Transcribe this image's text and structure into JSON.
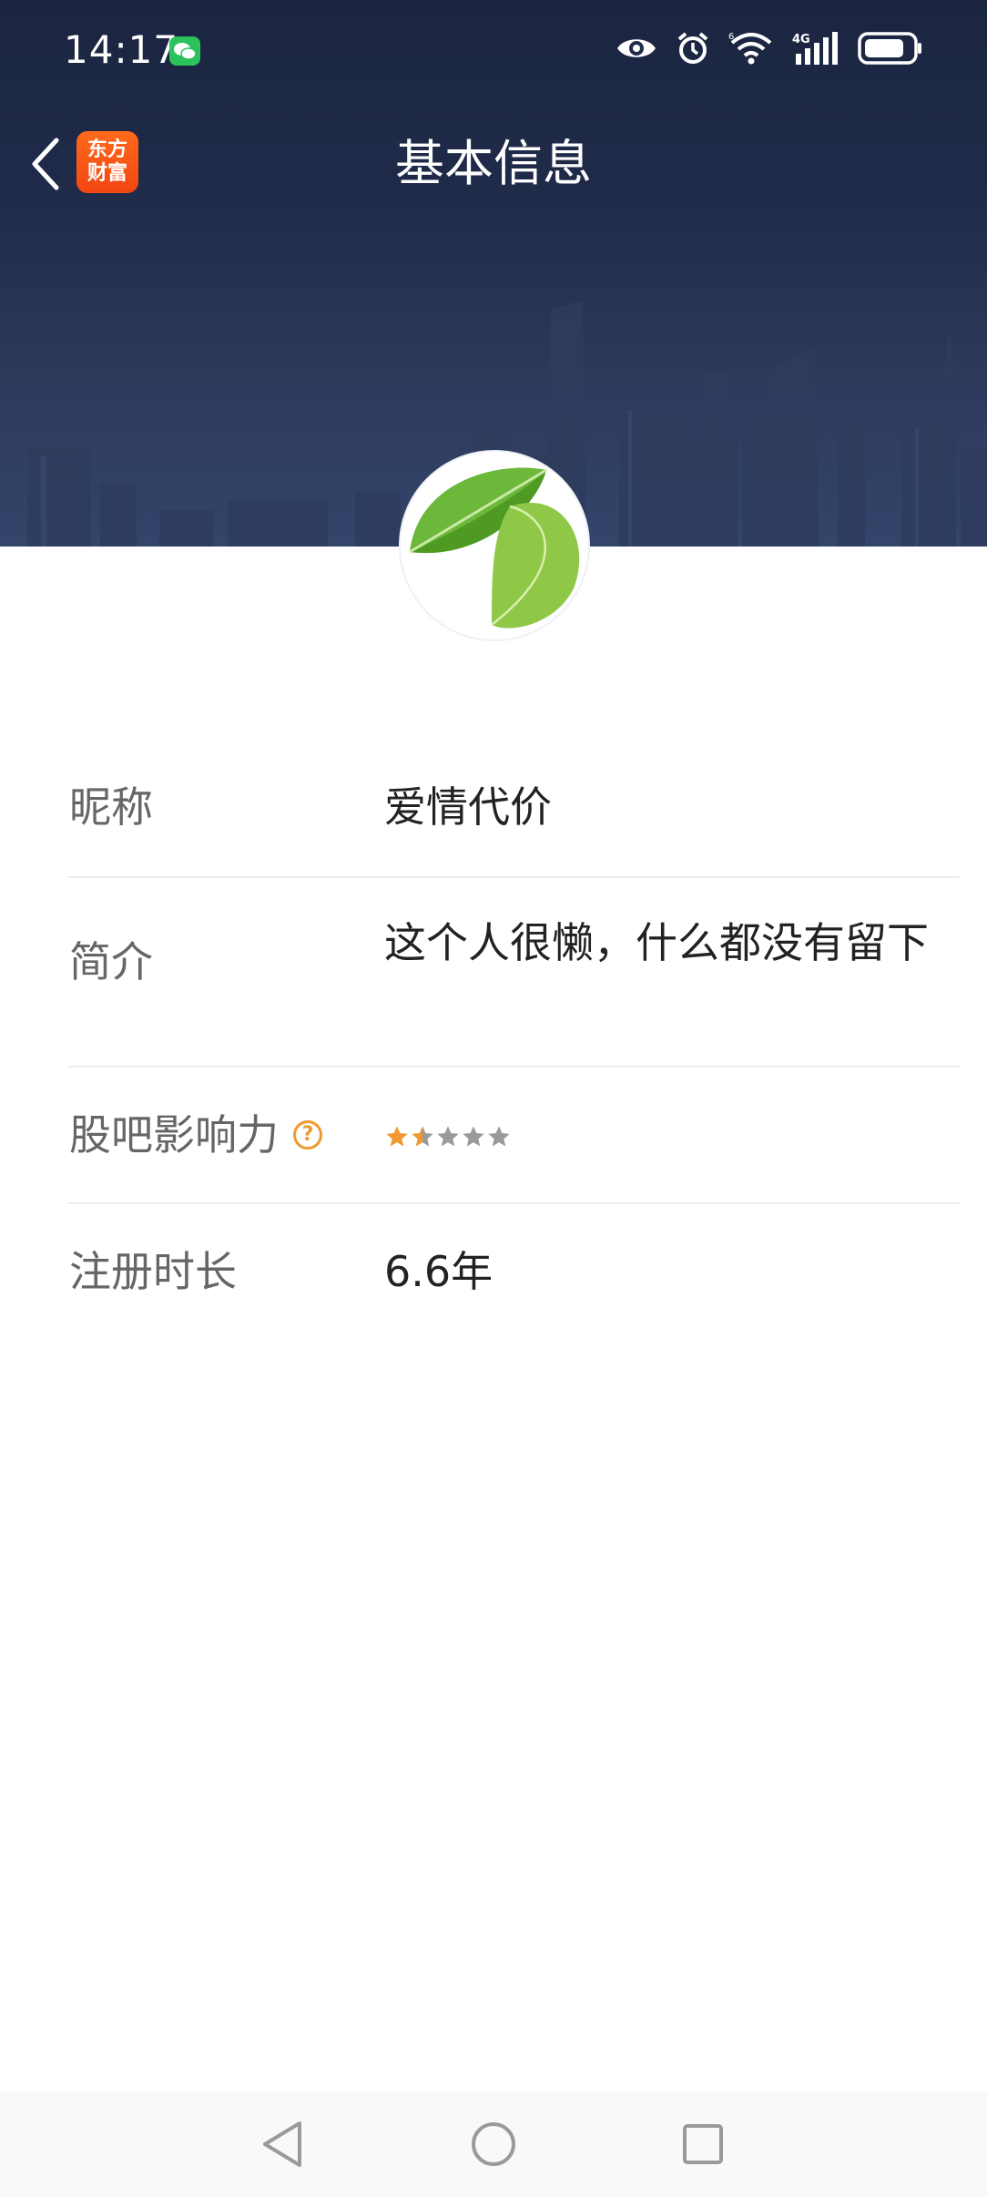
{
  "status_bar": {
    "time": "14:17",
    "icons": [
      "wechat-icon",
      "eye-icon",
      "alarm-icon",
      "wifi-icon",
      "signal-4g-icon",
      "battery-icon"
    ]
  },
  "nav": {
    "title": "基本信息",
    "app_logo_line1": "东方",
    "app_logo_line2": "财富",
    "back_icon": "chevron-left-icon"
  },
  "profile": {
    "rows": [
      {
        "label": "昵称",
        "value": "爱情代价"
      },
      {
        "label": "简介",
        "value": "这个人很懒，什么都没有留下"
      },
      {
        "label": "股吧影响力",
        "help_icon": "?",
        "rating": 1.5,
        "rating_max": 5
      },
      {
        "label": "注册时长",
        "value": "6.6年"
      }
    ]
  },
  "colors": {
    "banner": "#1f2b49",
    "accent_orange": "#f0992f",
    "star_inactive": "#9a9a9a",
    "label_text": "#666666",
    "value_text": "#222222"
  },
  "system_nav": {
    "icons": [
      "back-triangle-icon",
      "home-circle-icon",
      "recents-square-icon"
    ]
  }
}
